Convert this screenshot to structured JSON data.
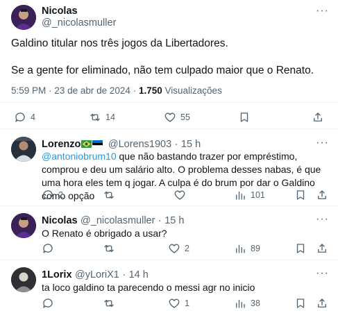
{
  "main_tweet": {
    "author_name": "Nicolas",
    "author_handle": "@_nicolasmuller",
    "paragraph_1": "Galdino titular nos três jogos da Libertadores.",
    "paragraph_2": "Se a gente for eliminado, não tem culpado maior que o Renato.",
    "time": "5:59 PM",
    "date_separator": "·",
    "date": "23 de abr de 2024",
    "views_separator": "·",
    "views_count": "1.750",
    "views_label": "Visualizações",
    "replies": "4",
    "retweets": "14",
    "likes": "55"
  },
  "replies": [
    {
      "author_name": "Lorenzo",
      "author_handle": "@Lorens1903",
      "separator": "·",
      "time": "15 h",
      "mention": "@antoniobrum10",
      "text": " que não bastando trazer por empréstimo, comprou e deu um salário alto. O problema desses nabas, é que uma hora eles tem q jogar. A culpa é do brum por dar o Galdino como opção",
      "replies": "2",
      "retweets": "",
      "likes": "",
      "views": "101"
    },
    {
      "author_name": "Nicolas",
      "author_handle": "@_nicolasmuller",
      "separator": "·",
      "time": "15 h",
      "text": "O Renato é obrigado a usar?",
      "replies": "",
      "retweets": "",
      "likes": "2",
      "views": "89"
    },
    {
      "author_name": "1Lorix",
      "author_handle": "@yLoriX1",
      "separator": "·",
      "time": "14 h",
      "text": "ta loco galdino ta parecendo o messi agr no inicio",
      "replies": "",
      "retweets": "",
      "likes": "1",
      "views": "38"
    }
  ],
  "more_label": "···",
  "colors": {
    "link": "#1d9bf0",
    "secondary_text": "#536471",
    "separator": "#eff3f4",
    "text": "#0f1419"
  },
  "icons": [
    "reply-icon",
    "retweet-icon",
    "like-icon",
    "views-icon",
    "bookmark-icon",
    "share-icon",
    "more-icon",
    "brazil-flag-icon",
    "estonia-flag-icon"
  ]
}
